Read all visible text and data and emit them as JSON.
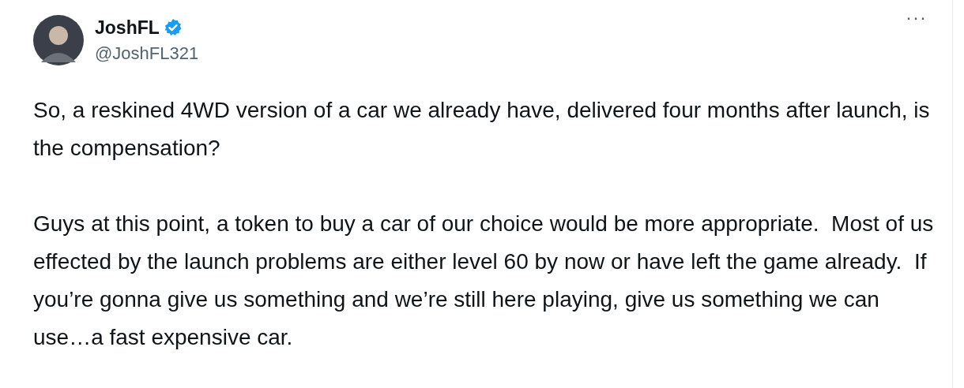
{
  "author": {
    "name": "JoshFL",
    "verified": true,
    "handle": "@JoshFL321"
  },
  "more_menu": "···",
  "paragraphs": [
    "So, a reskined 4WD version of a car we already have, delivered four months after launch, is the compensation?",
    "Guys at this point, a token to buy a car of our choice would be more appropriate.  Most of us effected by the launch problems are either level 60 by now or have left the game already.  If you’re gonna give us something and we’re still here playing, give us something we can use…a fast expensive car."
  ]
}
